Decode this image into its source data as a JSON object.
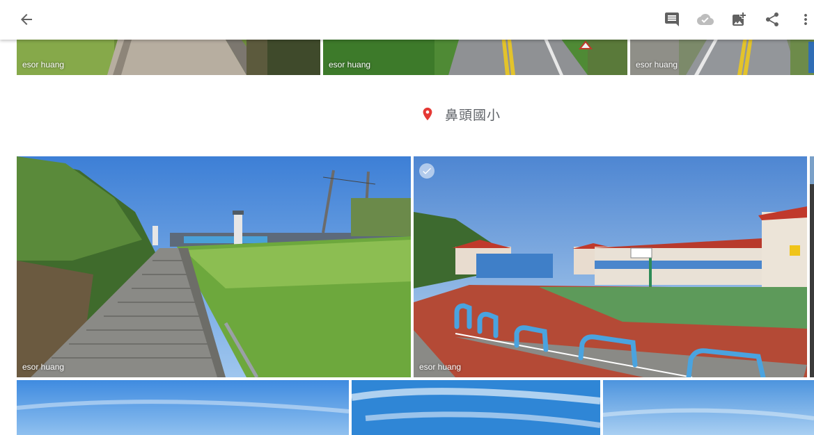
{
  "topbar": {
    "back_icon": "arrow-back-icon",
    "actions": [
      {
        "icon": "comment-icon",
        "color": "#616161"
      },
      {
        "icon": "cloud-done-icon",
        "color": "#bdbdbd"
      },
      {
        "icon": "add-photo-icon",
        "color": "#616161"
      },
      {
        "icon": "share-icon",
        "color": "#616161"
      },
      {
        "icon": "more-vert-icon",
        "color": "#616161"
      }
    ]
  },
  "top_row": [
    {
      "credit": "esor huang"
    },
    {
      "credit": "esor huang"
    },
    {
      "credit": "esor huang"
    }
  ],
  "location": {
    "icon": "location-pin-icon",
    "pin_color": "#e53935",
    "name": "鼻頭國小"
  },
  "middle_row": [
    {
      "credit": "esor huang"
    },
    {
      "credit": "esor huang",
      "selected_icon": "check-circle-icon"
    }
  ]
}
